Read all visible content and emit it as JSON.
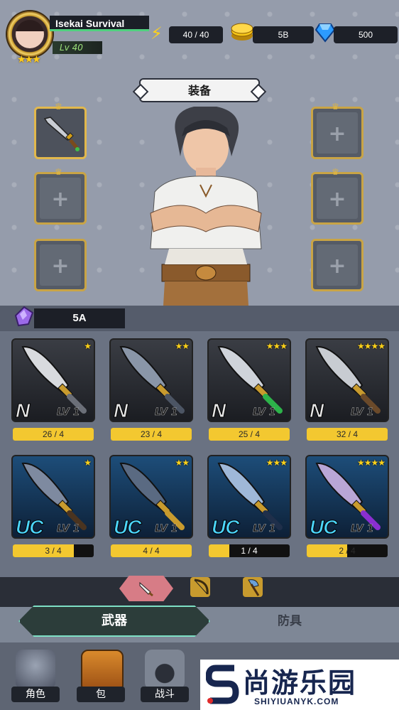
{
  "player": {
    "name": "Isekai Survival",
    "level": "Lv 40",
    "stars": "★★★"
  },
  "resources": {
    "energy": "40 / 40",
    "gold": "5B",
    "gems": "500"
  },
  "equipment": {
    "title": "装备",
    "slots": [
      "weapon",
      "empty",
      "empty",
      "empty",
      "empty",
      "empty"
    ]
  },
  "shard": {
    "value": "5A"
  },
  "weapons": [
    {
      "rank": "N",
      "lv_label": "LV",
      "lv": "1",
      "stars": "★",
      "progress": "26 / 4",
      "fill": 1.0
    },
    {
      "rank": "N",
      "lv_label": "LV",
      "lv": "1",
      "stars": "★★",
      "progress": "23 / 4",
      "fill": 1.0
    },
    {
      "rank": "N",
      "lv_label": "LV",
      "lv": "1",
      "stars": "★★★",
      "progress": "25 / 4",
      "fill": 1.0
    },
    {
      "rank": "N",
      "lv_label": "LV",
      "lv": "1",
      "stars": "★★★★",
      "progress": "32 / 4",
      "fill": 1.0
    },
    {
      "rank": "UC",
      "lv_label": "LV",
      "lv": "1",
      "stars": "★",
      "progress": "3 / 4",
      "fill": 0.75
    },
    {
      "rank": "UC",
      "lv_label": "LV",
      "lv": "1",
      "stars": "★★",
      "progress": "4 / 4",
      "fill": 1.0
    },
    {
      "rank": "UC",
      "lv_label": "LV",
      "lv": "1",
      "stars": "★★★",
      "progress": "1 / 4",
      "fill": 0.25
    },
    {
      "rank": "UC",
      "lv_label": "LV",
      "lv": "1",
      "stars": "★★★★",
      "progress": "2 / 4",
      "fill": 0.5
    }
  ],
  "tabs": {
    "weapon": "武器",
    "armor": "防具"
  },
  "nav": {
    "character": "角色",
    "bag": "包",
    "battle": "战斗"
  },
  "watermark": {
    "title": "尚游乐园",
    "url": "SHIYIUANYK.COM"
  },
  "colors": {
    "accent_gold": "#f3c830",
    "tab_active": "#7ee0c5",
    "uc_blue": "#4cd7ff"
  }
}
